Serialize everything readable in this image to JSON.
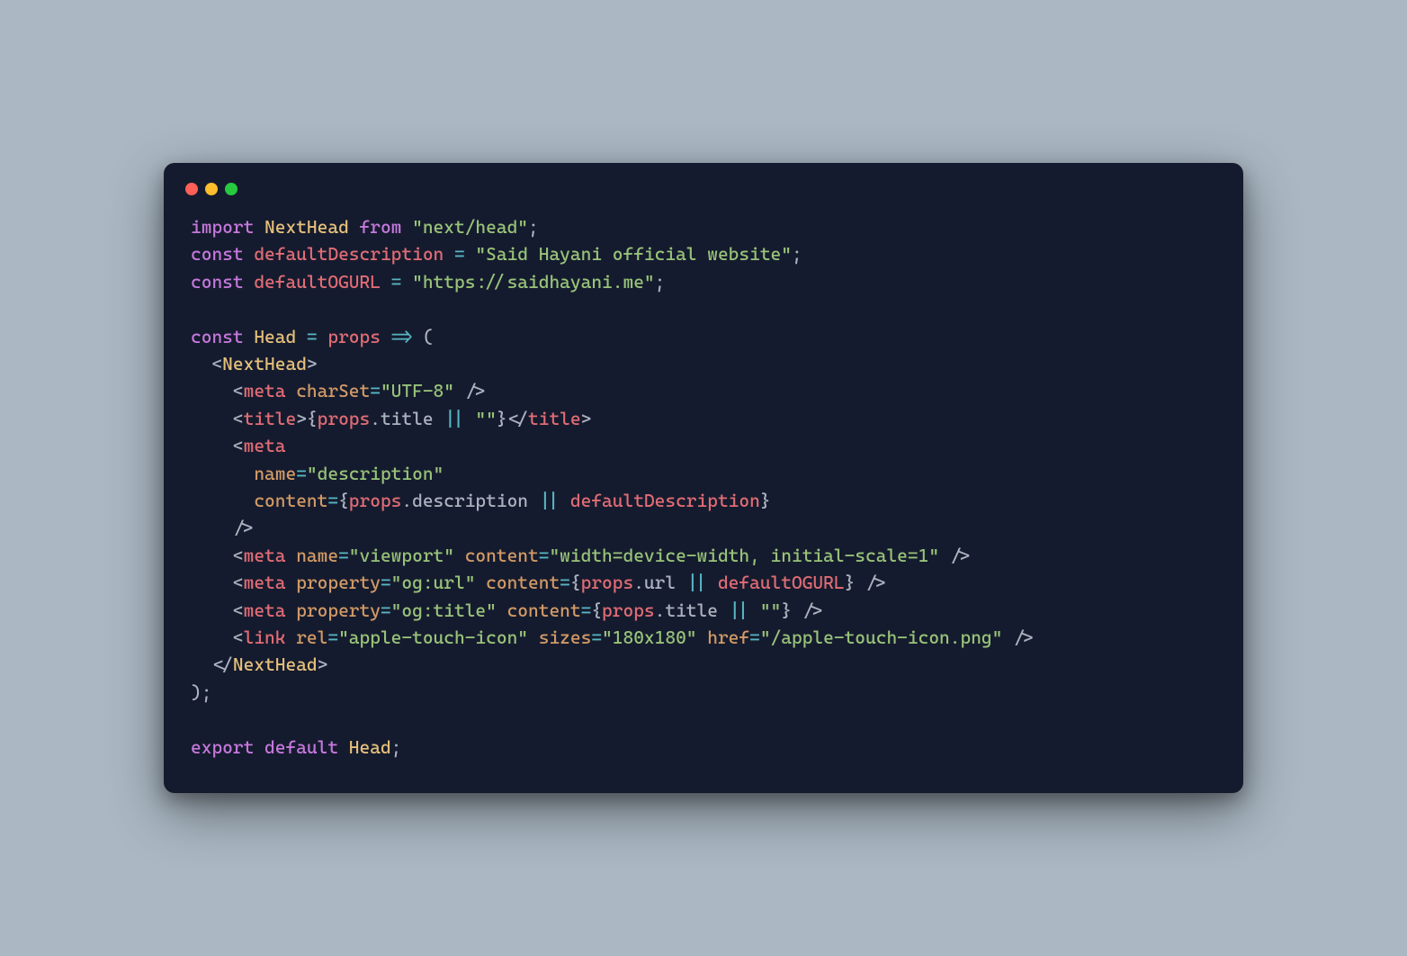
{
  "code": {
    "l1": {
      "import": "import",
      "NextHead": "NextHead",
      "from": "from",
      "str": "\"next/head\"",
      "semi": ";"
    },
    "l2": {
      "const": "const",
      "var": "defaultDescription",
      "eq": "=",
      "str": "\"Said Hayani official website\"",
      "semi": ";"
    },
    "l3": {
      "const": "const",
      "var": "defaultOGURL",
      "eq": "=",
      "str": "\"https://saidhayani.me\"",
      "semi": ";"
    },
    "l5": {
      "const": "const",
      "Head": "Head",
      "eq": "=",
      "props": "props",
      "arrow": "=>",
      "open": "("
    },
    "l6": {
      "open": "<",
      "NextHead": "NextHead",
      "close": ">"
    },
    "l7": {
      "open": "<",
      "meta": "meta",
      "charSet": "charSet",
      "eq": "=",
      "str": "\"UTF-8\"",
      "slashclose": "/>"
    },
    "l8": {
      "open": "<",
      "title": "title",
      "close": ">",
      "lbrace": "{",
      "props": "props",
      "dot": ".",
      "titleProp": "title",
      "or": "||",
      "str": "\"\"",
      "rbrace": "}",
      "closeOpen": "</",
      "title2": "title",
      "close2": ">"
    },
    "l9": {
      "open": "<",
      "meta": "meta"
    },
    "l10": {
      "name": "name",
      "eq": "=",
      "str": "\"description\""
    },
    "l11": {
      "content": "content",
      "eq": "=",
      "lbrace": "{",
      "props": "props",
      "dot": ".",
      "desc": "description",
      "or": "||",
      "defDesc": "defaultDescription",
      "rbrace": "}"
    },
    "l12": {
      "slashclose": "/>"
    },
    "l13": {
      "open": "<",
      "meta": "meta",
      "name": "name",
      "eq": "=",
      "str1": "\"viewport\"",
      "content": "content",
      "eq2": "=",
      "str2": "\"width=device-width, initial-scale=1\"",
      "slashclose": "/>"
    },
    "l14": {
      "open": "<",
      "meta": "meta",
      "property": "property",
      "eq": "=",
      "str": "\"og:url\"",
      "content": "content",
      "eq2": "=",
      "lbrace": "{",
      "props": "props",
      "dot": ".",
      "url": "url",
      "or": "||",
      "defOG": "defaultOGURL",
      "rbrace": "}",
      "slashclose": "/>"
    },
    "l15": {
      "open": "<",
      "meta": "meta",
      "property": "property",
      "eq": "=",
      "str": "\"og:title\"",
      "content": "content",
      "eq2": "=",
      "lbrace": "{",
      "props": "props",
      "dot": ".",
      "title": "title",
      "or": "||",
      "str2": "\"\"",
      "rbrace": "}",
      "slashclose": "/>"
    },
    "l16": {
      "open": "<",
      "link": "link",
      "rel": "rel",
      "eq": "=",
      "str1": "\"apple-touch-icon\"",
      "sizes": "sizes",
      "eq2": "=",
      "str2": "\"180x180\"",
      "href": "href",
      "eq3": "=",
      "str3": "\"/apple-touch-icon.png\"",
      "slashclose": "/>"
    },
    "l17": {
      "closeOpen": "</",
      "NextHead": "NextHead",
      "close": ">"
    },
    "l18": {
      "close": ")",
      "semi": ";"
    },
    "l20": {
      "export": "export",
      "default": "default",
      "Head": "Head",
      "semi": ";"
    }
  }
}
